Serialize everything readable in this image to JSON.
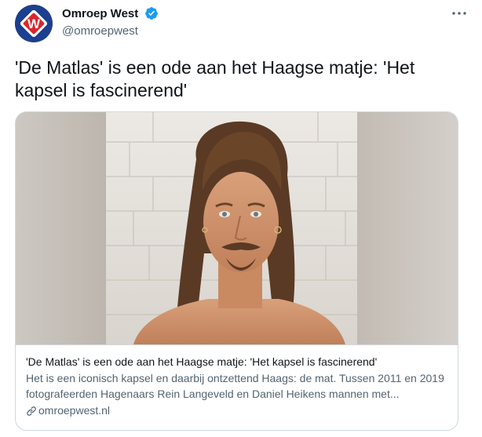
{
  "account": {
    "display_name": "Omroep West",
    "handle": "@omroepwest",
    "avatar_icon": "omroep-west-logo-icon",
    "verified": true,
    "avatar_letter": "W"
  },
  "menu": {
    "icon": "more-horizontal-icon"
  },
  "tweet": {
    "text": "'De Matlas' is een ode aan het Haagse matje: 'Het kapsel is fascinerend'"
  },
  "card": {
    "image_icon": "portrait-photo",
    "title": "'De Matlas' is een ode aan het Haagse matje: 'Het kapsel is fascinerend'",
    "description": "Het is een iconisch kapsel en daarbij ontzettend Haags: de mat. Tussen 2011 en 2019 fotografeerden Hagenaars Rein Langeveld en Daniel Heikens mannen met...",
    "domain": "omroepwest.nl",
    "domain_icon": "link-icon"
  },
  "colors": {
    "text_primary": "#0f1419",
    "text_secondary": "#536471",
    "border": "#cfd9de",
    "verified": "#1d9bf0",
    "brand_blue": "#1d3f8f",
    "brand_red": "#d9262d"
  }
}
